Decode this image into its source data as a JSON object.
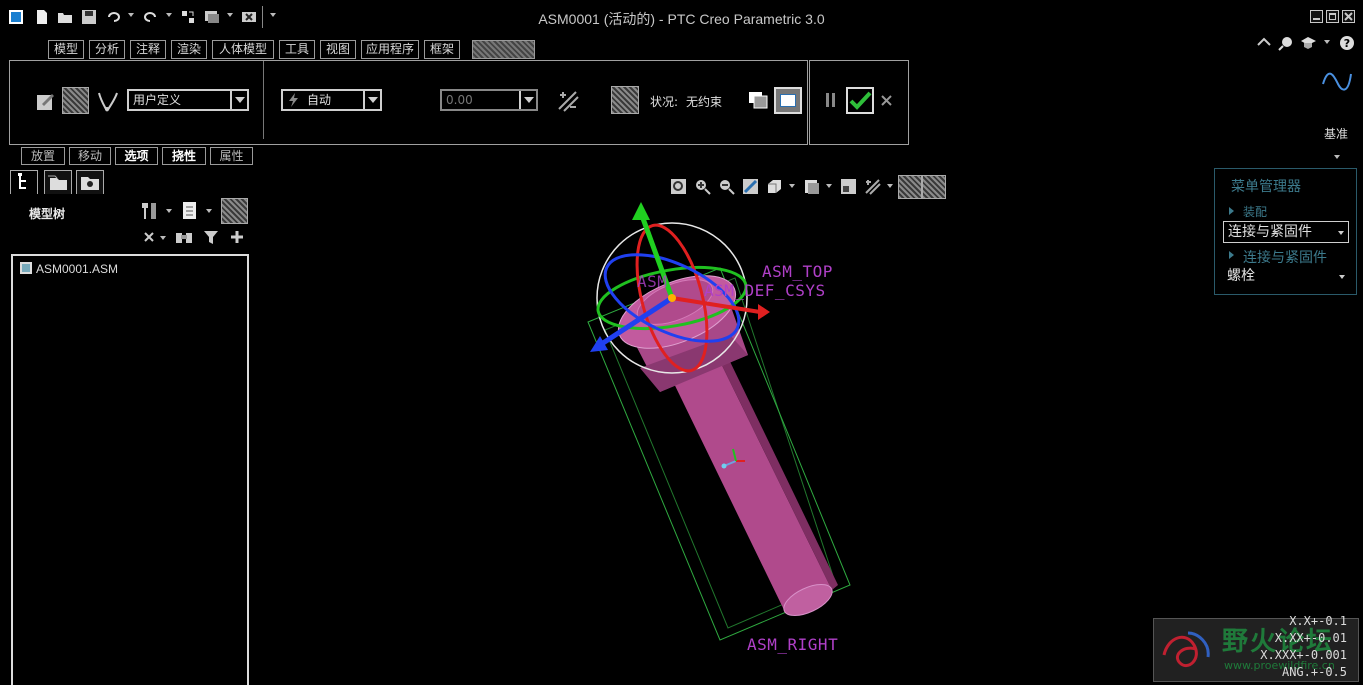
{
  "window": {
    "title": "ASM0001 (活动的) - PTC Creo Parametric 3.0"
  },
  "quick_access": [
    "app-icon",
    "new-file-icon",
    "open-file-icon",
    "save-icon",
    "undo-icon",
    "redo-icon",
    "regenerate-icon",
    "windows-icon",
    "close-window-icon"
  ],
  "ribbon": {
    "tabs": [
      "模型",
      "分析",
      "注释",
      "渲染",
      "人体模型",
      "工具",
      "视图",
      "应用程序",
      "框架"
    ]
  },
  "dashboard": {
    "constraint_set": "用户定义",
    "constraint_type": "自动",
    "offset_value": "0.00",
    "status_label": "状况:",
    "status_value": "无约束"
  },
  "dashboard_tabs": [
    "放置",
    "移动",
    "选项",
    "挠性",
    "属性"
  ],
  "navigator": {
    "title": "模型树",
    "tree_items": [
      "ASM0001.ASM"
    ]
  },
  "right_panel": {
    "datum_label": "基准",
    "menu_manager": {
      "title": "菜单管理器",
      "items": [
        "装配",
        "连接与紧固件",
        "连接与紧固件",
        "螺栓"
      ]
    }
  },
  "viewport": {
    "labels": {
      "top": "ASM_TOP",
      "csys": "ASM_DEF_CSYS",
      "csys_overlap": "ASM",
      "right": "ASM_RIGHT"
    },
    "tolerances": [
      "X.X+-0.1",
      "X.XX+-0.01",
      "X.XXX+-0.001",
      "ANG.+-0.5"
    ],
    "colors": {
      "bolt": "#b04a8c",
      "bbox": "#2faa40",
      "x_axis": "#e02020",
      "y_axis": "#20d020",
      "z_axis": "#2040f0"
    }
  },
  "watermark": {
    "text": "野火论坛",
    "url": "www.proewildfire.cn"
  }
}
